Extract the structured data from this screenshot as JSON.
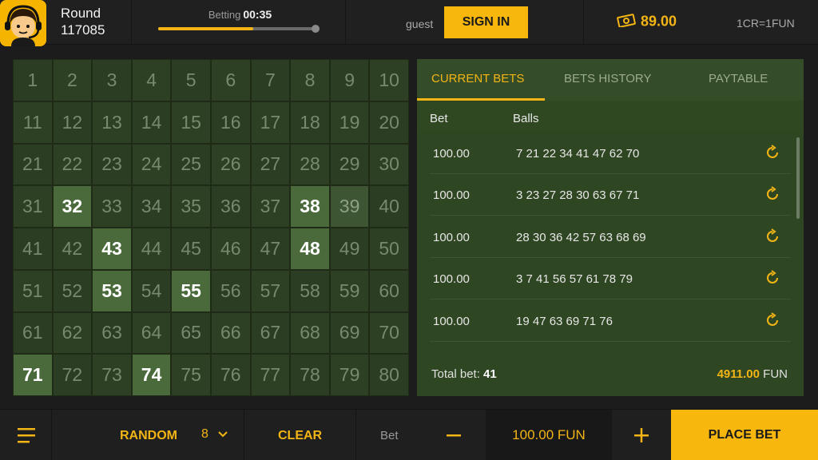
{
  "header": {
    "round_label": "Round",
    "round_number": "117085",
    "timer_label": "Betting",
    "timer_value": "00:35",
    "timer_progress": 0.6,
    "user_label": "guest",
    "signin_label": "SIGN IN",
    "balance": "89.00",
    "rate": "1CR=1FUN"
  },
  "board": {
    "numbers": [
      1,
      2,
      3,
      4,
      5,
      6,
      7,
      8,
      9,
      10,
      11,
      12,
      13,
      14,
      15,
      16,
      17,
      18,
      19,
      20,
      21,
      22,
      23,
      24,
      25,
      26,
      27,
      28,
      29,
      30,
      31,
      32,
      33,
      34,
      35,
      36,
      37,
      38,
      39,
      40,
      41,
      42,
      43,
      44,
      45,
      46,
      47,
      48,
      49,
      50,
      51,
      52,
      53,
      54,
      55,
      56,
      57,
      58,
      59,
      60,
      61,
      62,
      63,
      64,
      65,
      66,
      67,
      68,
      69,
      70,
      71,
      72,
      73,
      74,
      75,
      76,
      77,
      78,
      79,
      80
    ],
    "drawn": [
      32,
      38,
      43,
      48,
      53,
      55,
      71,
      74
    ],
    "dim_highlight": [
      39
    ]
  },
  "panel": {
    "tabs": [
      "CURRENT BETS",
      "BETS HISTORY",
      "PAYTABLE"
    ],
    "active_tab": 0,
    "col_bet": "Bet",
    "col_balls": "Balls",
    "bets": [
      {
        "amount": "100.00",
        "balls": "7 21 22 34 41 47 62 70"
      },
      {
        "amount": "100.00",
        "balls": "3 23 27 28 30 63 67 71"
      },
      {
        "amount": "100.00",
        "balls": "28 30 36 42 57 63 68 69"
      },
      {
        "amount": "100.00",
        "balls": "3 7 41 56 57 61 78 79"
      },
      {
        "amount": "100.00",
        "balls": "19 47 63 69 71 76"
      }
    ],
    "total_bet_label": "Total bet:",
    "total_bet_count": "41",
    "total_amount": "4911.00",
    "total_currency": "FUN"
  },
  "bottom": {
    "random_label": "RANDOM",
    "random_count": "8",
    "clear_label": "CLEAR",
    "bet_label": "Bet",
    "bet_value": "100.00 FUN",
    "place_label": "PLACE BET"
  },
  "colors": {
    "accent": "#f7b70c",
    "board_bg": "#2b3d22",
    "drawn_cell": "#4a6a3c",
    "panel_bg": "#2f4622"
  },
  "icons": {
    "avatar": "support-agent-icon",
    "balance": "cash-icon",
    "repeat": "repeat-icon",
    "menu": "hamburger-menu-icon",
    "dropdown": "chevron-down-icon",
    "minus": "minus-icon",
    "plus": "plus-icon"
  }
}
